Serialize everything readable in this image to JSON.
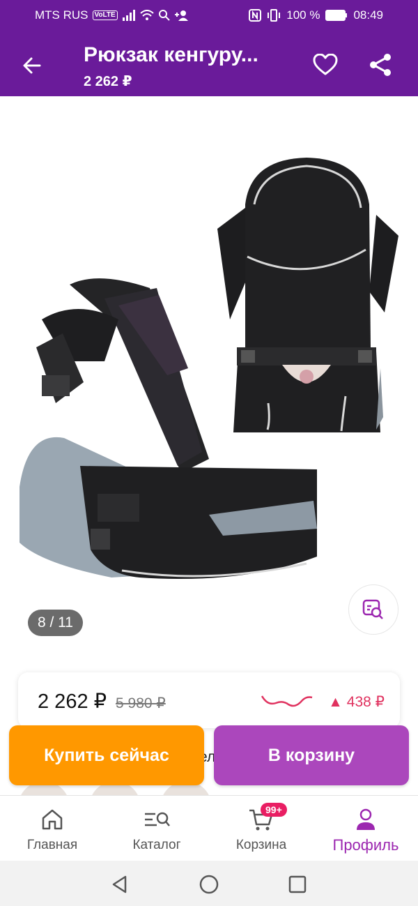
{
  "status_bar": {
    "carrier": "MTS RUS",
    "volte": "VoLTE",
    "battery": "100 %",
    "time": "08:49"
  },
  "app_bar": {
    "title": "Рюкзак кенгуру...",
    "price": "2 262 ₽"
  },
  "gallery": {
    "page_indicator": "8 / 11"
  },
  "price_card": {
    "current": "2 262 ₽",
    "old": "5 980 ₽",
    "diff": "▲ 438 ₽"
  },
  "peek": {
    "text": "ел"
  },
  "actions": {
    "buy_now": "Купить сейчас",
    "add_to_cart": "В корзину"
  },
  "bottom_nav": {
    "items": [
      {
        "label": "Главная"
      },
      {
        "label": "Каталог"
      },
      {
        "label": "Корзина",
        "badge": "99+"
      },
      {
        "label": "Профиль"
      }
    ]
  },
  "colors": {
    "primary": "#6a1b9a",
    "accent": "#ab47bc",
    "buy_now": "#ff9800",
    "price_up": "#e0325f",
    "active_nav": "#9c27b0"
  }
}
